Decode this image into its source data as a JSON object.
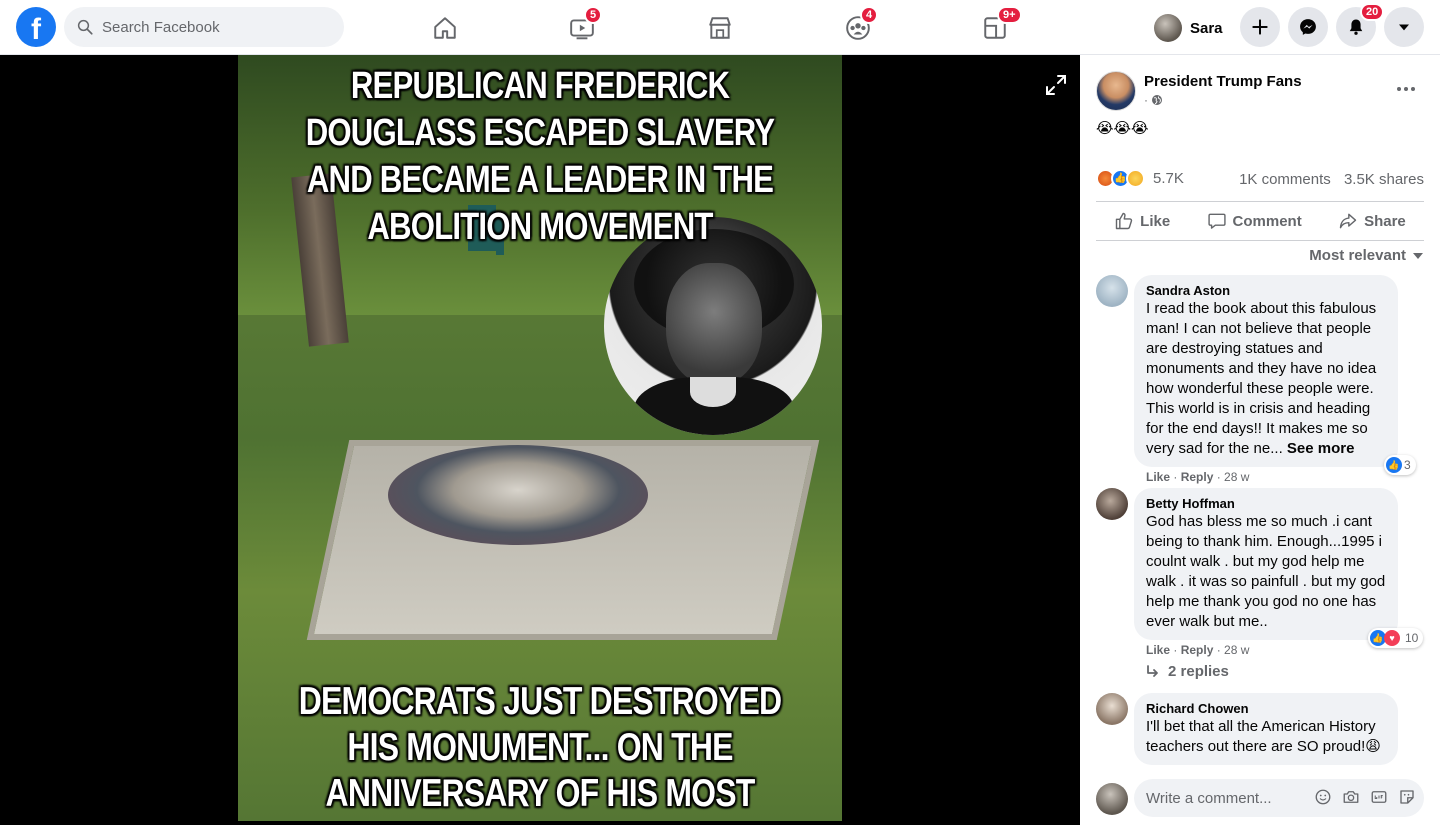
{
  "header": {
    "logo_letter": "f",
    "search": {
      "placeholder": "Search Facebook"
    },
    "nav": [
      {
        "name": "home",
        "badge": ""
      },
      {
        "name": "watch",
        "badge": "5"
      },
      {
        "name": "marketplace",
        "badge": ""
      },
      {
        "name": "groups",
        "badge": "4"
      },
      {
        "name": "gaming",
        "badge": "9+"
      }
    ],
    "user": {
      "name": "Sara"
    },
    "notifications_badge": "20"
  },
  "media": {
    "headline_top": "REPUBLICAN FREDERICK DOUGLASS ESCAPED SLAVERY AND BECAME A LEADER IN THE ABOLITION MOVEMENT",
    "headline_bottom": "DEMOCRATS JUST DESTROYED HIS MONUMENT... ON THE ANNIVERSARY OF HIS MOST FAMOUS SPEECH"
  },
  "post": {
    "page_name": "President Trump Fans",
    "meta": "·",
    "text": "😭😭😭",
    "reaction_count": "5.7K",
    "comments_count": "1K comments",
    "shares_count": "3.5K shares",
    "actions": {
      "like": "Like",
      "comment": "Comment",
      "share": "Share"
    },
    "sort_label": "Most relevant"
  },
  "comments": [
    {
      "author": "Sandra Aston",
      "text": "I read the book about this fabulous man! I can not believe that people are destroying statues and monuments and they have no idea how wonderful these people were. This world is in crisis and heading for the end days!! It makes me so very sad for the ne...",
      "see_more": "See more",
      "like": "Like",
      "reply": "Reply",
      "time": "28 w",
      "reactions": "3"
    },
    {
      "author": "Betty Hoffman",
      "text": "God has bless me so much .i cant being to thank him. Enough...1995 i coulnt walk . but my god help me walk . it was so painfull . but my god help me thank you god no one has ever walk but me..",
      "like": "Like",
      "reply": "Reply",
      "time": "28 w",
      "reactions": "10",
      "replies": "2 replies"
    },
    {
      "author": "Richard Chowen",
      "text": "I'll bet that all the American History teachers out there are SO proud!😩"
    }
  ],
  "composer": {
    "placeholder": "Write a comment..."
  },
  "colors": {
    "brand": "#1877f2",
    "badge": "#e41e3f",
    "text_secondary": "#65676b"
  }
}
